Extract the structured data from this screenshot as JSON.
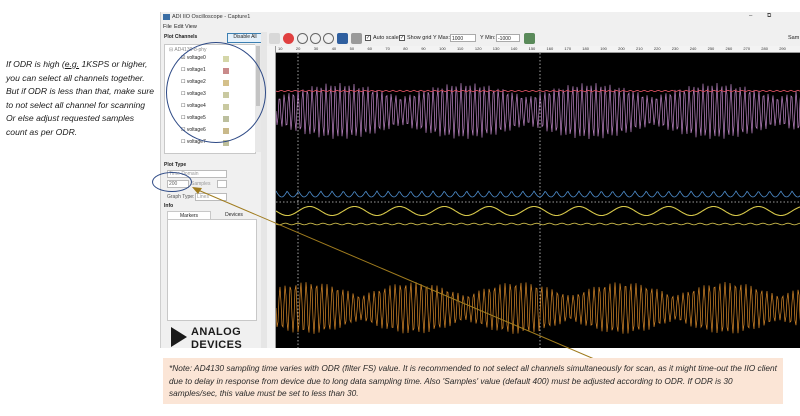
{
  "left_note": {
    "part1": "If ODR is high (",
    "eg": "e.g.",
    "part2": " 1KSPS or higher, you can select all channels together. But if ODR is less than that, make sure to not select all channel for scanning Or else adjust requested samples count as per ODR."
  },
  "window": {
    "title": "ADI IIO Oscilloscope - Capture1",
    "minimize": "–",
    "restore": "⧉",
    "menu": [
      "File",
      "Edit",
      "View"
    ]
  },
  "sidebar": {
    "plot_channels_label": "Plot Channels",
    "disable_all_label": "Disable All",
    "device_name": "AD4130-8-phy",
    "channels": [
      {
        "name": "voltage0",
        "color": "#d4d6a8"
      },
      {
        "name": "voltage1",
        "color": "#c98a8a"
      },
      {
        "name": "voltage2",
        "color": "#d4c08a"
      },
      {
        "name": "voltage3",
        "color": "#c9c9a0"
      },
      {
        "name": "voltage4",
        "color": "#c9c9a0"
      },
      {
        "name": "voltage5",
        "color": "#bcbf9e"
      },
      {
        "name": "voltage6",
        "color": "#c9b98a"
      },
      {
        "name": "voltage7",
        "color": "#bfbf9a"
      }
    ],
    "plot_type_label": "Plot Type",
    "domain_value": "Time Domain",
    "samples_value": "200",
    "samples_unit": "Samples",
    "graph_type_label": "Graph Type:",
    "graph_type_value": "Lines",
    "info_label": "Info",
    "tabs": [
      "Markers",
      "Devices"
    ]
  },
  "logo": {
    "line1": "ANALOG",
    "line2": "DEVICES"
  },
  "toolbar": {
    "auto_scale_label": "Auto scale",
    "show_grid_label": "Show grid",
    "ymax_label": "Y Max:",
    "ymax_value": "1000",
    "ymin_label": "Y Min:",
    "ymin_value": "-1000",
    "samples_right": "Sam"
  },
  "ruler_ticks": [
    "10",
    "20",
    "30",
    "40",
    "50",
    "60",
    "70",
    "80",
    "90",
    "100",
    "110",
    "120",
    "130",
    "140",
    "150",
    "160",
    "170",
    "180",
    "190",
    "200",
    "210",
    "220",
    "230",
    "240",
    "250",
    "260",
    "270",
    "280",
    "290"
  ],
  "note": {
    "text": "*Note: AD4130 sampling time varies with ODR (filter FS) value. It is recommended to not select all channels simultaneously for scan, as it might time-out the IIO client due to delay in response from device due to long data sampling time. Also 'Samples' value (default 400) must be adjusted according to ODR. If ODR is 30 samples/sec, this value must be set to less than 30."
  },
  "colors": {
    "trace_red": "#c94a5a",
    "trace_pink": "#c088c8",
    "trace_blue": "#4f8fcf",
    "trace_yellow": "#d7c84a",
    "trace_orange": "#d98a2a",
    "trace_olive": "#c9b84a",
    "annotation_blue": "#2e4a86",
    "arrow": "#a07c1e",
    "note_bg": "#fbe5d6"
  }
}
